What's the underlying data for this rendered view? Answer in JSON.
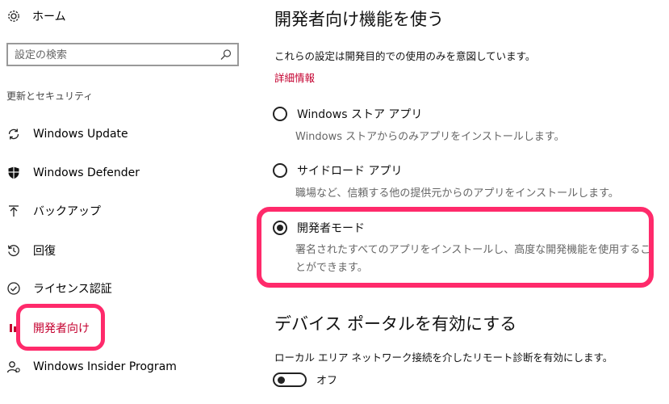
{
  "sidebar": {
    "home_label": "ホーム",
    "search_placeholder": "設定の検索",
    "section_title": "更新とセキュリティ",
    "items": [
      {
        "label": "Windows Update",
        "icon": "refresh-icon"
      },
      {
        "label": "Windows Defender",
        "icon": "shield-icon"
      },
      {
        "label": "バックアップ",
        "icon": "upload-arrow-icon"
      },
      {
        "label": "回復",
        "icon": "history-icon"
      },
      {
        "label": "ライセンス認証",
        "icon": "check-circle-icon"
      },
      {
        "label": "開発者向け",
        "icon": "developer-icon",
        "active": true
      },
      {
        "label": "Windows Insider Program",
        "icon": "insider-person-icon"
      }
    ]
  },
  "main": {
    "title": "開発者向け機能を使う",
    "description": "これらの設定は開発目的での使用のみを意図しています。",
    "details_link": "詳細情報",
    "options": [
      {
        "label": "Windows ストア アプリ",
        "sub": "Windows ストアからのみアプリをインストールします。",
        "selected": false
      },
      {
        "label": "サイドロード アプリ",
        "sub": "職場など、信頼する他の提供元からのアプリをインストールします。",
        "selected": false
      },
      {
        "label": "開発者モード",
        "sub_line1": "署名されたすべてのアプリをインストールし、高度な開発機能を使用するこ",
        "sub_line2": "とができます。",
        "selected": true
      }
    ],
    "portal_title": "デバイス ポータルを有効にする",
    "portal_description": "ローカル エリア ネットワーク接続を介したリモート診断を有効にします。",
    "portal_toggle_state": "オフ"
  },
  "colors": {
    "accent": "#c4002f",
    "highlight": "#ff2a6b"
  }
}
